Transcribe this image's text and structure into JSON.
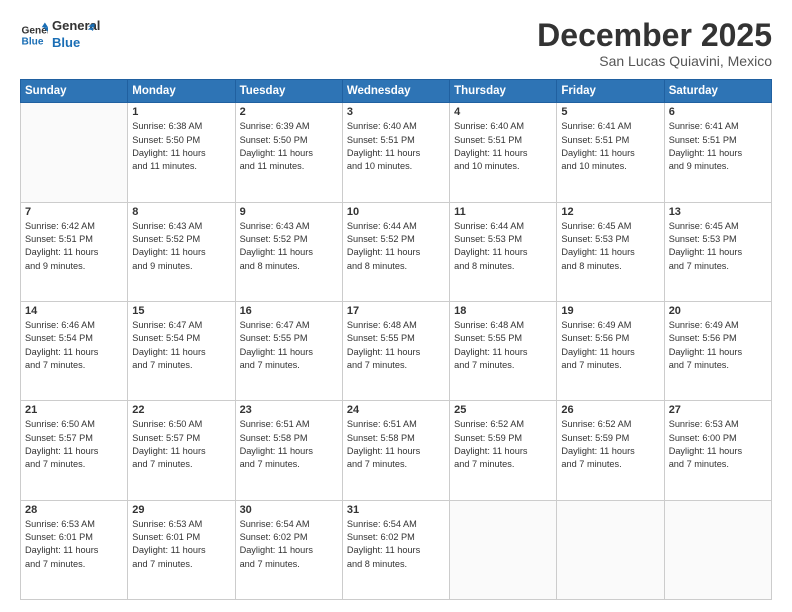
{
  "header": {
    "logo_line1": "General",
    "logo_line2": "Blue",
    "month": "December 2025",
    "location": "San Lucas Quiavini, Mexico"
  },
  "weekdays": [
    "Sunday",
    "Monday",
    "Tuesday",
    "Wednesday",
    "Thursday",
    "Friday",
    "Saturday"
  ],
  "weeks": [
    [
      {
        "day": "",
        "info": ""
      },
      {
        "day": "1",
        "info": "Sunrise: 6:38 AM\nSunset: 5:50 PM\nDaylight: 11 hours\nand 11 minutes."
      },
      {
        "day": "2",
        "info": "Sunrise: 6:39 AM\nSunset: 5:50 PM\nDaylight: 11 hours\nand 11 minutes."
      },
      {
        "day": "3",
        "info": "Sunrise: 6:40 AM\nSunset: 5:51 PM\nDaylight: 11 hours\nand 10 minutes."
      },
      {
        "day": "4",
        "info": "Sunrise: 6:40 AM\nSunset: 5:51 PM\nDaylight: 11 hours\nand 10 minutes."
      },
      {
        "day": "5",
        "info": "Sunrise: 6:41 AM\nSunset: 5:51 PM\nDaylight: 11 hours\nand 10 minutes."
      },
      {
        "day": "6",
        "info": "Sunrise: 6:41 AM\nSunset: 5:51 PM\nDaylight: 11 hours\nand 9 minutes."
      }
    ],
    [
      {
        "day": "7",
        "info": "Sunrise: 6:42 AM\nSunset: 5:51 PM\nDaylight: 11 hours\nand 9 minutes."
      },
      {
        "day": "8",
        "info": "Sunrise: 6:43 AM\nSunset: 5:52 PM\nDaylight: 11 hours\nand 9 minutes."
      },
      {
        "day": "9",
        "info": "Sunrise: 6:43 AM\nSunset: 5:52 PM\nDaylight: 11 hours\nand 8 minutes."
      },
      {
        "day": "10",
        "info": "Sunrise: 6:44 AM\nSunset: 5:52 PM\nDaylight: 11 hours\nand 8 minutes."
      },
      {
        "day": "11",
        "info": "Sunrise: 6:44 AM\nSunset: 5:53 PM\nDaylight: 11 hours\nand 8 minutes."
      },
      {
        "day": "12",
        "info": "Sunrise: 6:45 AM\nSunset: 5:53 PM\nDaylight: 11 hours\nand 8 minutes."
      },
      {
        "day": "13",
        "info": "Sunrise: 6:45 AM\nSunset: 5:53 PM\nDaylight: 11 hours\nand 7 minutes."
      }
    ],
    [
      {
        "day": "14",
        "info": "Sunrise: 6:46 AM\nSunset: 5:54 PM\nDaylight: 11 hours\nand 7 minutes."
      },
      {
        "day": "15",
        "info": "Sunrise: 6:47 AM\nSunset: 5:54 PM\nDaylight: 11 hours\nand 7 minutes."
      },
      {
        "day": "16",
        "info": "Sunrise: 6:47 AM\nSunset: 5:55 PM\nDaylight: 11 hours\nand 7 minutes."
      },
      {
        "day": "17",
        "info": "Sunrise: 6:48 AM\nSunset: 5:55 PM\nDaylight: 11 hours\nand 7 minutes."
      },
      {
        "day": "18",
        "info": "Sunrise: 6:48 AM\nSunset: 5:55 PM\nDaylight: 11 hours\nand 7 minutes."
      },
      {
        "day": "19",
        "info": "Sunrise: 6:49 AM\nSunset: 5:56 PM\nDaylight: 11 hours\nand 7 minutes."
      },
      {
        "day": "20",
        "info": "Sunrise: 6:49 AM\nSunset: 5:56 PM\nDaylight: 11 hours\nand 7 minutes."
      }
    ],
    [
      {
        "day": "21",
        "info": "Sunrise: 6:50 AM\nSunset: 5:57 PM\nDaylight: 11 hours\nand 7 minutes."
      },
      {
        "day": "22",
        "info": "Sunrise: 6:50 AM\nSunset: 5:57 PM\nDaylight: 11 hours\nand 7 minutes."
      },
      {
        "day": "23",
        "info": "Sunrise: 6:51 AM\nSunset: 5:58 PM\nDaylight: 11 hours\nand 7 minutes."
      },
      {
        "day": "24",
        "info": "Sunrise: 6:51 AM\nSunset: 5:58 PM\nDaylight: 11 hours\nand 7 minutes."
      },
      {
        "day": "25",
        "info": "Sunrise: 6:52 AM\nSunset: 5:59 PM\nDaylight: 11 hours\nand 7 minutes."
      },
      {
        "day": "26",
        "info": "Sunrise: 6:52 AM\nSunset: 5:59 PM\nDaylight: 11 hours\nand 7 minutes."
      },
      {
        "day": "27",
        "info": "Sunrise: 6:53 AM\nSunset: 6:00 PM\nDaylight: 11 hours\nand 7 minutes."
      }
    ],
    [
      {
        "day": "28",
        "info": "Sunrise: 6:53 AM\nSunset: 6:01 PM\nDaylight: 11 hours\nand 7 minutes."
      },
      {
        "day": "29",
        "info": "Sunrise: 6:53 AM\nSunset: 6:01 PM\nDaylight: 11 hours\nand 7 minutes."
      },
      {
        "day": "30",
        "info": "Sunrise: 6:54 AM\nSunset: 6:02 PM\nDaylight: 11 hours\nand 7 minutes."
      },
      {
        "day": "31",
        "info": "Sunrise: 6:54 AM\nSunset: 6:02 PM\nDaylight: 11 hours\nand 8 minutes."
      },
      {
        "day": "",
        "info": ""
      },
      {
        "day": "",
        "info": ""
      },
      {
        "day": "",
        "info": ""
      }
    ]
  ]
}
